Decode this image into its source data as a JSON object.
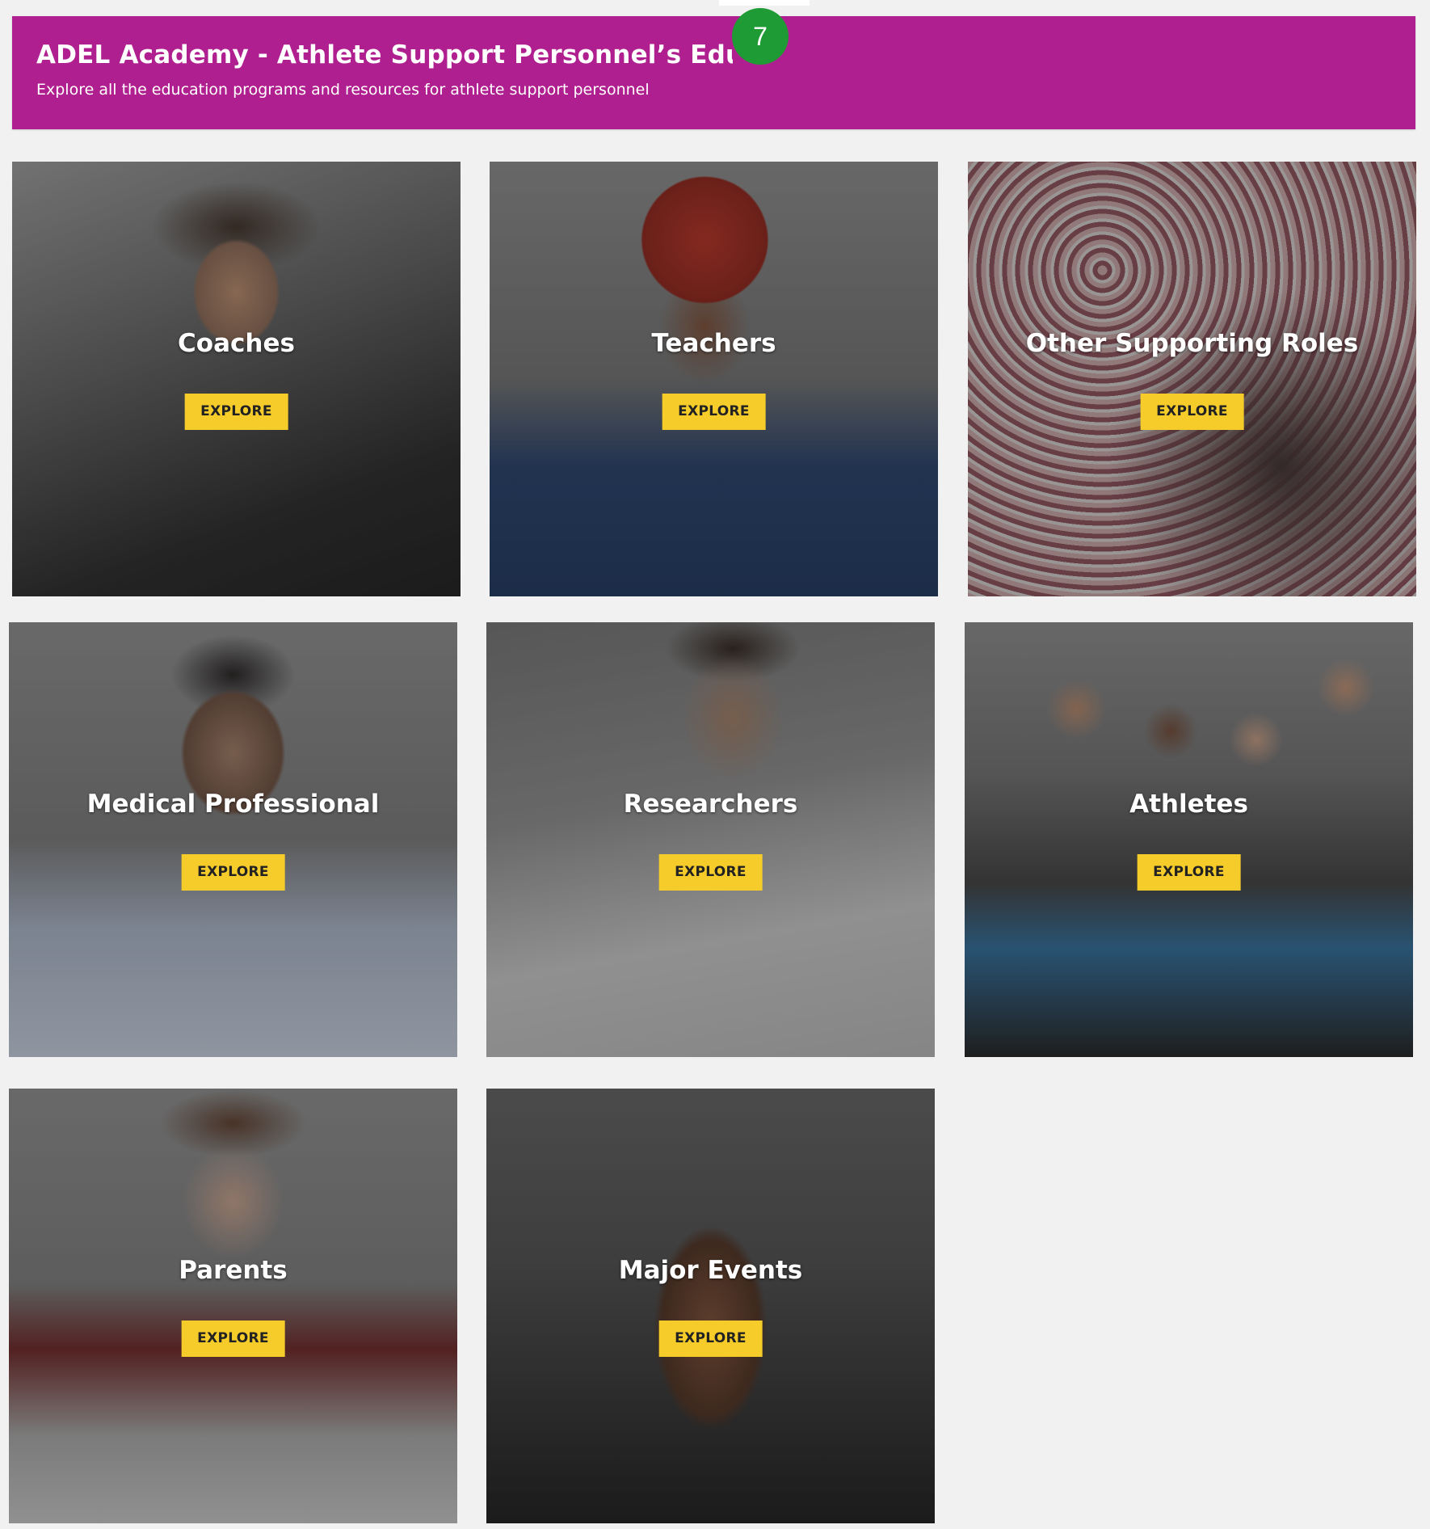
{
  "header": {
    "title": "ADEL Academy - Athlete Support Personnel’s Education",
    "subtitle": "Explore all the education programs and resources for athlete support personnel",
    "color": "#b01f8f"
  },
  "badge": {
    "value": "7",
    "color": "#1e9b34"
  },
  "explore_button_color": "#f5cc2a",
  "cards": [
    {
      "label": "Coaches",
      "button": "EXPLORE"
    },
    {
      "label": "Teachers",
      "button": "EXPLORE"
    },
    {
      "label": "Other Supporting Roles",
      "button": "EXPLORE"
    },
    {
      "label": "Medical Professional",
      "button": "EXPLORE"
    },
    {
      "label": "Researchers",
      "button": "EXPLORE"
    },
    {
      "label": "Athletes",
      "button": "EXPLORE"
    },
    {
      "label": "Parents",
      "button": "EXPLORE"
    },
    {
      "label": "Major Events",
      "button": "EXPLORE"
    }
  ]
}
